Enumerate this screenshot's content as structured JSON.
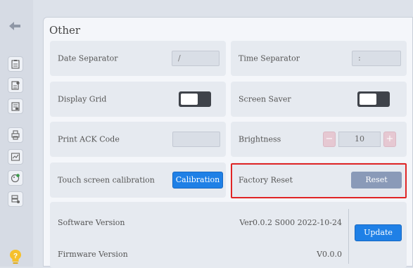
{
  "sidebar": {
    "icons": [
      "back-arrow-icon",
      "clipboard-icon",
      "settings-doc-icon",
      "list-doc-icon",
      "printer-icon",
      "chart-icon",
      "palette-icon",
      "database-icon",
      "help-icon"
    ]
  },
  "panel": {
    "title": "Other"
  },
  "settings": {
    "date_separator": {
      "label": "Date Separator",
      "value": "/"
    },
    "time_separator": {
      "label": "Time Separator",
      "value": ":"
    },
    "display_grid": {
      "label": "Display Grid"
    },
    "screen_saver": {
      "label": "Screen Saver"
    },
    "print_ack_code": {
      "label": "Print ACK Code",
      "value": ""
    },
    "brightness": {
      "label": "Brightness",
      "value": "10",
      "minus": "−",
      "plus": "+"
    },
    "touch_calibration": {
      "label": "Touch screen calibration",
      "button": "Calibration"
    },
    "factory_reset": {
      "label": "Factory Reset",
      "button": "Reset"
    }
  },
  "versions": {
    "software_label": "Software Version",
    "software_value": "Ver0.0.2 S000 2022-10-24",
    "firmware_label": "Firmware Version",
    "firmware_value": "V0.0.0",
    "update_button": "Update"
  },
  "colors": {
    "accent": "#1f80e6",
    "highlight": "#e02525",
    "reset_button": "#8a9ab8"
  }
}
